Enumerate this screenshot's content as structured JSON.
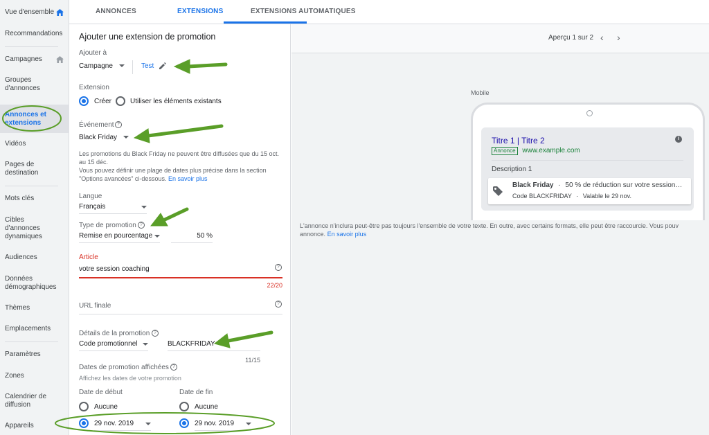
{
  "sidebar": {
    "items": [
      {
        "label": "Vue d'ensemble"
      },
      {
        "label": "Recommandations"
      },
      {
        "label": "Campagnes"
      },
      {
        "label": "Groupes d'annonces"
      },
      {
        "label": "Annonces et extensions"
      },
      {
        "label": "Vidéos"
      },
      {
        "label": "Pages de destination"
      },
      {
        "label": "Mots clés"
      },
      {
        "label": "Cibles d'annonces dynamiques"
      },
      {
        "label": "Audiences"
      },
      {
        "label": "Données démographiques"
      },
      {
        "label": "Thèmes"
      },
      {
        "label": "Emplacements"
      },
      {
        "label": "Paramètres"
      },
      {
        "label": "Zones"
      },
      {
        "label": "Calendrier de diffusion"
      },
      {
        "label": "Appareils"
      }
    ]
  },
  "tabs": [
    {
      "label": "ANNONCES"
    },
    {
      "label": "EXTENSIONS"
    },
    {
      "label": "EXTENSIONS AUTOMATIQUES"
    }
  ],
  "form": {
    "title": "Ajouter une extension de promotion",
    "add_to_label": "Ajouter à",
    "add_to_level": "Campagne",
    "add_to_value": "Test",
    "extension_label": "Extension",
    "radio_create": "Créer",
    "radio_existing": "Utiliser les éléments existants",
    "event_label": "Événement",
    "event_value": "Black Friday",
    "event_note_1": "Les promotions du Black Friday ne peuvent être diffusées que du 15 oct. au 15 déc.",
    "event_note_2": "Vous pouvez définir une plage de dates plus précise dans la section \"Options avancées\" ci-dessous.",
    "event_note_link": "En savoir plus",
    "language_label": "Langue",
    "language_value": "Français",
    "promo_type_label": "Type de promotion",
    "promo_type_value": "Remise en pourcentage",
    "percent_value": "50",
    "percent_unit": "%",
    "article_label": "Article",
    "article_value": "votre session coaching",
    "article_counter": "22/20",
    "final_url_placeholder": "URL finale",
    "promo_details_label": "Détails de la promotion",
    "promo_details_type": "Code promotionnel",
    "promo_code_value": "BLACKFRIDAY",
    "promo_code_counter": "11/15",
    "promo_dates_label": "Dates de promotion affichées",
    "promo_dates_hint": "Affichez les dates de votre promotion",
    "start_label": "Date de début",
    "end_label": "Date de fin",
    "start_none": "Aucune",
    "end_none": "Aucune",
    "start_date": "29 nov. 2019",
    "end_date": "29 nov. 2019"
  },
  "preview": {
    "pager": "Aperçu 1 sur 2",
    "device_label": "Mobile",
    "ad_title": "Titre 1 | Titre 2",
    "ad_badge": "Annonce",
    "ad_url": "www.example.com",
    "ad_description": "Description 1",
    "promo_name": "Black Friday",
    "promo_sep_1": "·",
    "promo_text": "50 % de réduction sur votre session…",
    "promo_code": "Code BLACKFRIDAY",
    "promo_sep_2": "·",
    "promo_valid": "Valable le 29 nov.",
    "note": "L'annonce n'inclura peut-être pas toujours l'ensemble de votre texte. En outre, avec certains formats, elle peut être raccourcie. Vous pouv",
    "note_2": "annonce.",
    "note_link": "En savoir plus"
  },
  "colors": {
    "accent": "#1a73e8",
    "error": "#d93025",
    "annotation_green": "#5a9e28"
  }
}
